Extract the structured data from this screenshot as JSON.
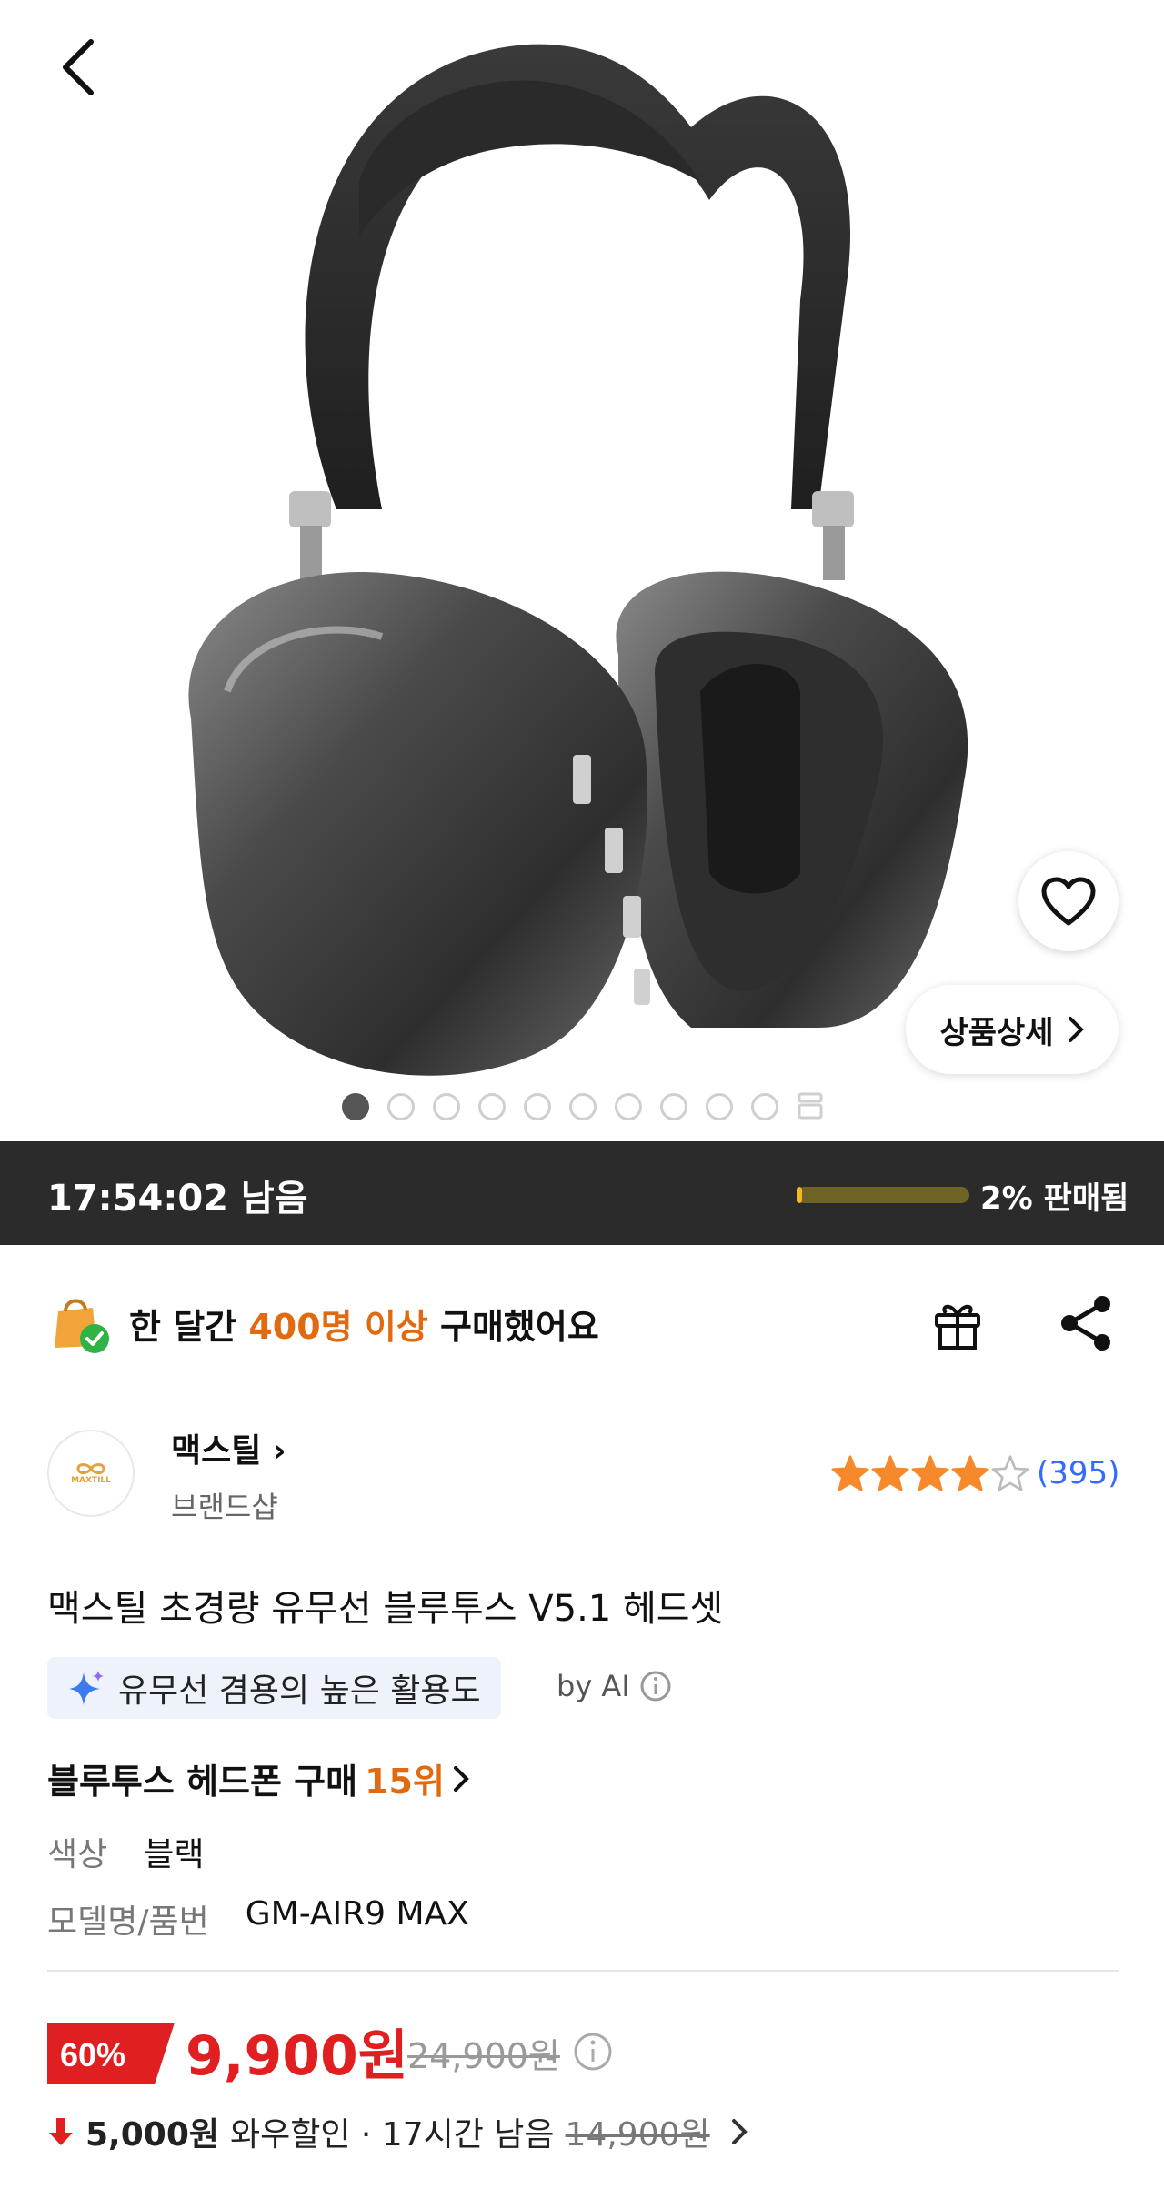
{
  "hero": {
    "image_desc_icon": "headphones-image",
    "detail_button_label": "상품상세",
    "carousel": {
      "total": 10,
      "active_index": 0
    }
  },
  "timer_bar": {
    "remaining_text": "17:54:02 남음",
    "sold_progress": 0.02,
    "sold_text": "2% 판매됨",
    "track_color": "#6e6225",
    "fill_color": "#f2b81c"
  },
  "buyers": {
    "prefix": "한 달간 ",
    "highlight": "400명 이상",
    "suffix": " 구매했어요"
  },
  "brand": {
    "logo_text": "MAXTILL",
    "name": "맥스틸",
    "sub": "브랜드샵",
    "rating_stars": 4,
    "review_count": "(395)"
  },
  "product": {
    "title": "맥스틸 초경량 유무선 블루투스 V5.1 헤드셋",
    "ai_summary": "유무선 겸용의 높은 활용도",
    "ai_label": "by AI",
    "rank_prefix": "블루투스 헤드폰 구매 ",
    "rank_value": "15위",
    "specs": [
      {
        "key": "색상",
        "value": "블랙"
      },
      {
        "key": "모델명/품번",
        "value": "GM-AIR9 MAX"
      }
    ]
  },
  "price": {
    "discount_rate": "60%",
    "sale_price": "9,900원",
    "original_price": "24,900원",
    "wow_amount": "5,000원",
    "wow_label": "와우할인 · 17시간 남음",
    "wow_original": "14,900원"
  },
  "colors": {
    "accent_orange": "#e16a10",
    "price_red": "#e02020",
    "link_blue": "#346aff",
    "star": "#f5892b"
  }
}
